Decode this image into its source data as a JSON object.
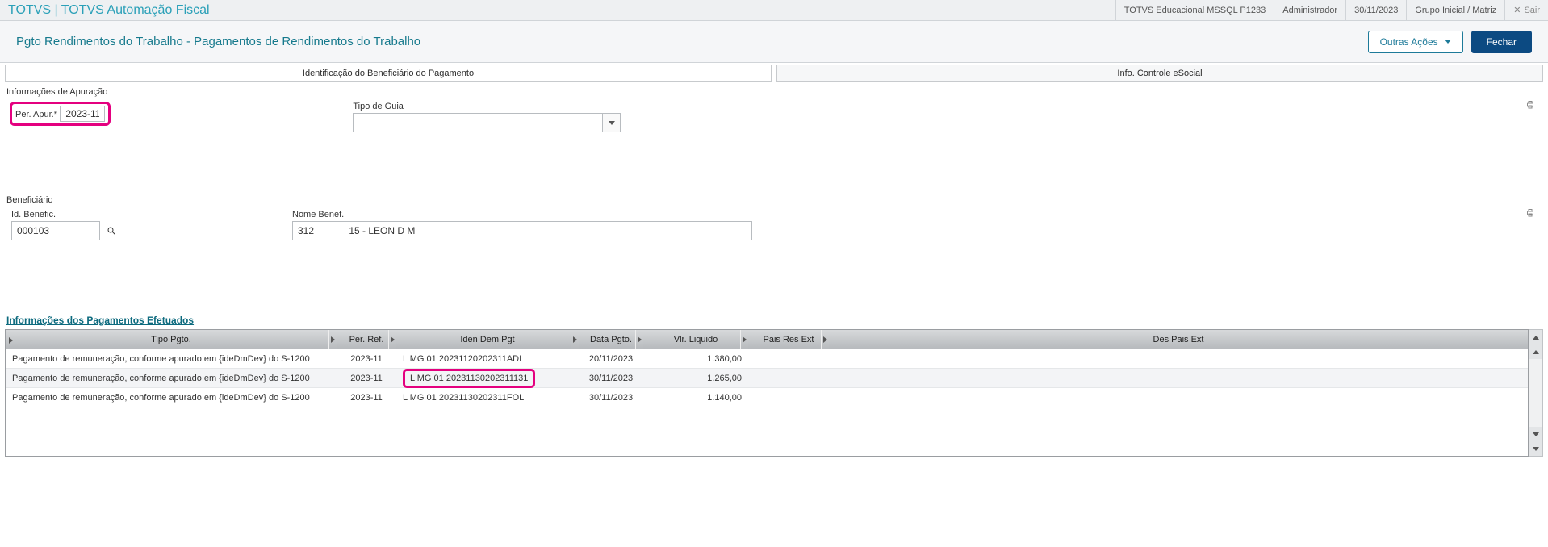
{
  "header": {
    "app_title": "TOTVS | TOTVS Automação Fiscal",
    "env": "TOTVS Educacional MSSQL P1233",
    "user": "Administrador",
    "date": "30/11/2023",
    "group": "Grupo Inicial / Matriz",
    "exit_label": "Sair"
  },
  "titlebar": {
    "page_title": "Pgto Rendimentos do Trabalho - Pagamentos de Rendimentos do Trabalho",
    "other_actions_label": "Outras Ações",
    "close_label": "Fechar"
  },
  "tabs": {
    "tab1": "Identificação do Beneficiário do Pagamento",
    "tab2": "Info. Controle eSocial"
  },
  "sections": {
    "info_apuracao_label": "Informações de Apuração",
    "beneficiario_label": "Beneficiário"
  },
  "fields": {
    "per_apur_label": "Per. Apur.*",
    "per_apur_value": "2023-11",
    "tipo_guia_label": "Tipo de Guia",
    "tipo_guia_value": "",
    "id_benefic_label": "Id. Benefic.",
    "id_benefic_value": "000103",
    "nome_benef_label": "Nome Benef.",
    "nome_benef_value": "312             15 - LEON D M"
  },
  "payments": {
    "title": "Informações dos Pagamentos Efetuados",
    "columns": {
      "tipo": "Tipo Pgto.",
      "per_ref": "Per. Ref.",
      "iden": "Iden Dem Pgt",
      "data": "Data Pgto.",
      "vlr": "Vlr. Liquido",
      "pais_res": "Pais Res Ext",
      "des_pais": "Des Pais Ext"
    },
    "rows": [
      {
        "tipo": "Pagamento de remuneração, conforme apurado em {ideDmDev} do S-1200",
        "per_ref": "2023-11",
        "iden": "L MG 01 20231120202311ADI",
        "data": "20/11/2023",
        "vlr": "1.380,00",
        "pais": "",
        "des": ""
      },
      {
        "tipo": "Pagamento de remuneração, conforme apurado em {ideDmDev} do S-1200",
        "per_ref": "2023-11",
        "iden": "L MG 01 20231130202311131",
        "data": "30/11/2023",
        "vlr": "1.265,00",
        "pais": "",
        "des": ""
      },
      {
        "tipo": "Pagamento de remuneração, conforme apurado em {ideDmDev} do S-1200",
        "per_ref": "2023-11",
        "iden": "L MG 01 20231130202311FOL",
        "data": "30/11/2023",
        "vlr": "1.140,00",
        "pais": "",
        "des": ""
      }
    ]
  }
}
